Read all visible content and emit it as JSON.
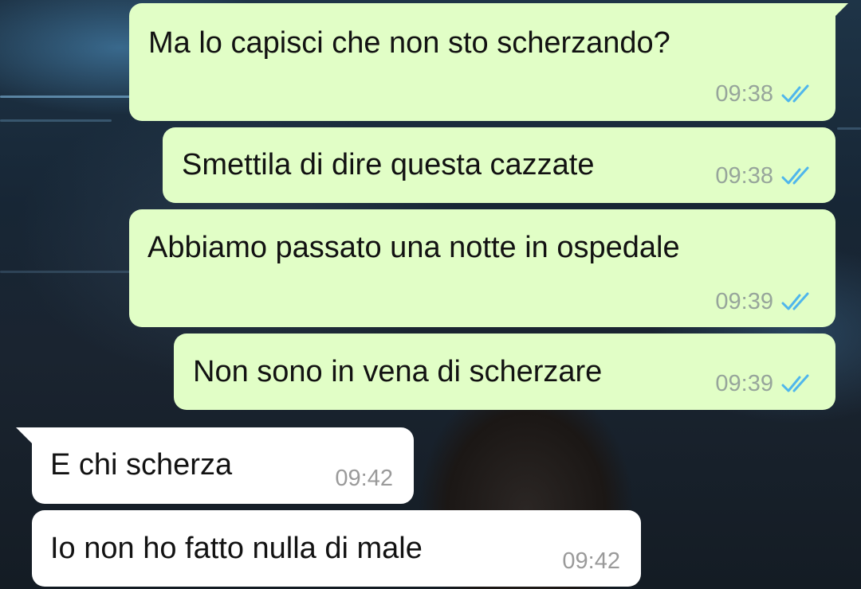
{
  "chat": {
    "messages": [
      {
        "direction": "outgoing",
        "text": "Ma lo capisci che non sto scherzando?",
        "time": "09:38",
        "status": "read-double-check-icon"
      },
      {
        "direction": "outgoing",
        "text": "Smettila di dire questa cazzate",
        "time": "09:38",
        "status": "read-double-check-icon"
      },
      {
        "direction": "outgoing",
        "text": "Abbiamo passato una notte in ospedale",
        "time": "09:39",
        "status": "read-double-check-icon"
      },
      {
        "direction": "outgoing",
        "text": "Non sono in vena di scherzare",
        "time": "09:39",
        "status": "read-double-check-icon"
      },
      {
        "direction": "incoming",
        "text": "E chi scherza",
        "time": "09:42"
      },
      {
        "direction": "incoming",
        "text": "Io non ho fatto nulla di male",
        "time": "09:42"
      }
    ]
  },
  "colors": {
    "outgoing_bubble": "#e1fec6",
    "incoming_bubble": "#ffffff",
    "read_ticks": "#4fb6ec",
    "timestamp": "#97a59b"
  }
}
